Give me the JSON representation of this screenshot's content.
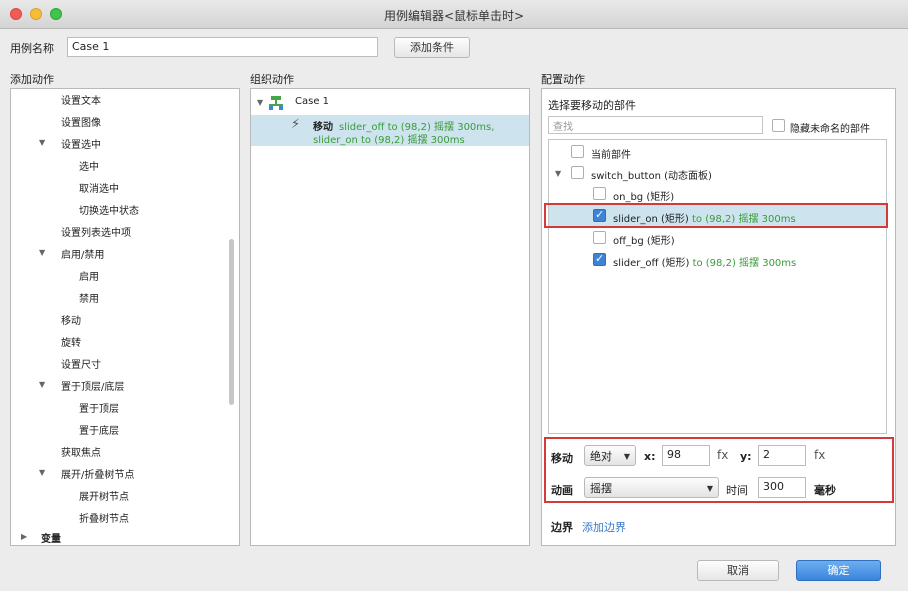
{
  "window": {
    "title": "用例编辑器<鼠标单击时>"
  },
  "case": {
    "label": "用例名称",
    "value": "Case 1",
    "add_condition": "添加条件"
  },
  "headers": {
    "add_action": "添加动作",
    "organize_action": "组织动作",
    "configure_action": "配置动作"
  },
  "actions_tree": [
    {
      "label": "设置文本",
      "level": 1
    },
    {
      "label": "设置图像",
      "level": 1
    },
    {
      "label": "设置选中",
      "level": 1,
      "expanded": true
    },
    {
      "label": "选中",
      "level": 2
    },
    {
      "label": "取消选中",
      "level": 2
    },
    {
      "label": "切换选中状态",
      "level": 2
    },
    {
      "label": "设置列表选中项",
      "level": 1
    },
    {
      "label": "启用/禁用",
      "level": 1,
      "expanded": true
    },
    {
      "label": "启用",
      "level": 2
    },
    {
      "label": "禁用",
      "level": 2
    },
    {
      "label": "移动",
      "level": 1
    },
    {
      "label": "旋转",
      "level": 1
    },
    {
      "label": "设置尺寸",
      "level": 1
    },
    {
      "label": "置于顶层/底层",
      "level": 1,
      "expanded": true
    },
    {
      "label": "置于顶层",
      "level": 2
    },
    {
      "label": "置于底层",
      "level": 2
    },
    {
      "label": "获取焦点",
      "level": 1
    },
    {
      "label": "展开/折叠树节点",
      "level": 1,
      "expanded": true
    },
    {
      "label": "展开树节点",
      "level": 2
    },
    {
      "label": "折叠树节点",
      "level": 2
    },
    {
      "label": "变量",
      "level": 0,
      "collapsed": true
    }
  ],
  "organize": {
    "case_name": "Case 1",
    "action_prefix": "移动",
    "action_line1": "slider_off to (98,2) 摇摆 300ms,",
    "action_line2": "slider_on to (98,2) 摇摆 300ms"
  },
  "configure": {
    "select_label": "选择要移动的部件",
    "search_placeholder": "查找",
    "hide_unnamed": "隐藏未命名的部件",
    "widgets": [
      {
        "name": "当前部件",
        "checked": false,
        "suffix": ""
      },
      {
        "name": "switch_button (动态面板)",
        "checked": false,
        "suffix": ""
      },
      {
        "name": "on_bg (矩形)",
        "checked": false,
        "suffix": ""
      },
      {
        "name": "slider_on (矩形)",
        "checked": true,
        "suffix": "to (98,2) 摇摆 300ms"
      },
      {
        "name": "off_bg (矩形)",
        "checked": false,
        "suffix": ""
      },
      {
        "name": "slider_off (矩形)",
        "checked": true,
        "suffix": "to (98,2) 摇摆 300ms"
      }
    ],
    "move_label": "移动",
    "move_mode": "绝对",
    "x_label": "x:",
    "x_value": "98",
    "y_label": "y:",
    "y_value": "2",
    "fx": "fx",
    "anim_label": "动画",
    "anim_value": "摇摆",
    "time_label": "时间",
    "time_value": "300",
    "time_unit": "毫秒",
    "border_label": "边界",
    "add_border": "添加边界"
  },
  "buttons": {
    "cancel": "取消",
    "ok": "确定"
  },
  "colors": {
    "highlight_red": "#d43a3a",
    "selection": "#cde4ee",
    "primary": "#3a84dc",
    "action_green": "#3a9a3a"
  }
}
